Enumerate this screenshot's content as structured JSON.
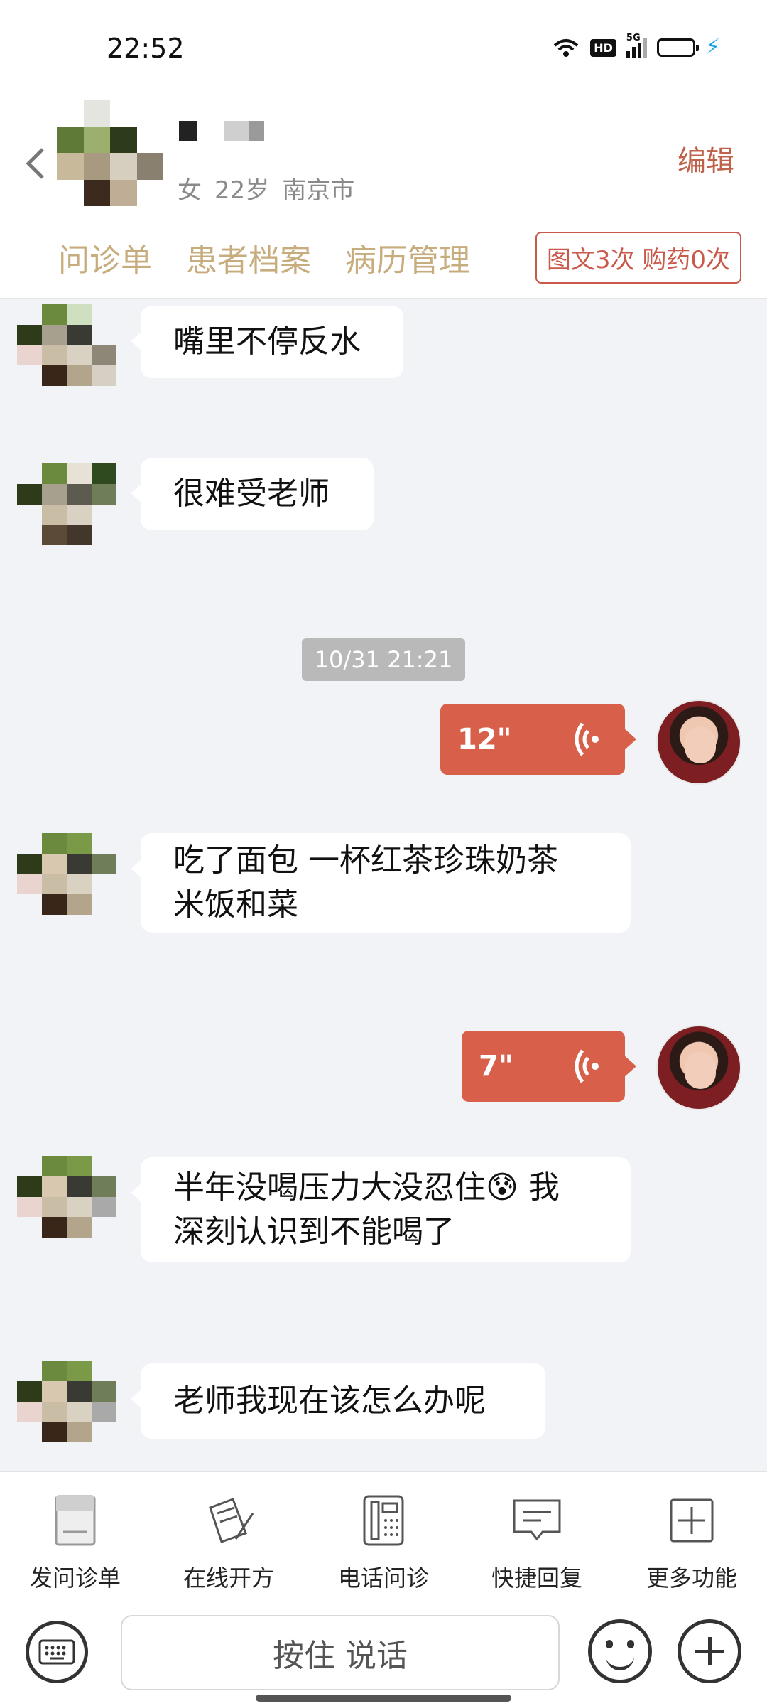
{
  "status_bar": {
    "time": "22:52",
    "hd_label": "HD",
    "network_label": "5G"
  },
  "header": {
    "gender": "女",
    "age": "22岁",
    "city": "南京市",
    "edit_label": "编辑",
    "tabs": [
      "问诊单",
      "患者档案",
      "病历管理"
    ],
    "quota": "图文3次 购药0次"
  },
  "chat": {
    "messages": [
      {
        "sender": "patient",
        "text": "嘴里不停反水"
      },
      {
        "sender": "patient",
        "text": "很难受老师"
      },
      {
        "timestamp": "10/31 21:21"
      },
      {
        "sender": "doctor",
        "voice_duration": "12\""
      },
      {
        "sender": "patient",
        "line1": "吃了面包 一杯红茶珍珠奶茶",
        "line2": "米饭和菜"
      },
      {
        "sender": "doctor",
        "voice_duration": "7\""
      },
      {
        "sender": "patient",
        "line1": "半年没喝压力大没忍住😰 我",
        "line2": "深刻认识到不能喝了"
      },
      {
        "sender": "patient",
        "text": "老师我现在该怎么办呢"
      }
    ]
  },
  "toolbar": {
    "items": [
      {
        "label": "发问诊单",
        "icon": "form-icon"
      },
      {
        "label": "在线开方",
        "icon": "prescription-icon"
      },
      {
        "label": "电话问诊",
        "icon": "phone-icon"
      },
      {
        "label": "快捷回复",
        "icon": "quick-reply-icon"
      },
      {
        "label": "更多功能",
        "icon": "more-icon"
      }
    ]
  },
  "input_bar": {
    "hold_to_talk": "按住 说话"
  },
  "colors": {
    "accent": "#d85f49",
    "tab_text": "#c7ad7e",
    "edit": "#c0624a"
  }
}
